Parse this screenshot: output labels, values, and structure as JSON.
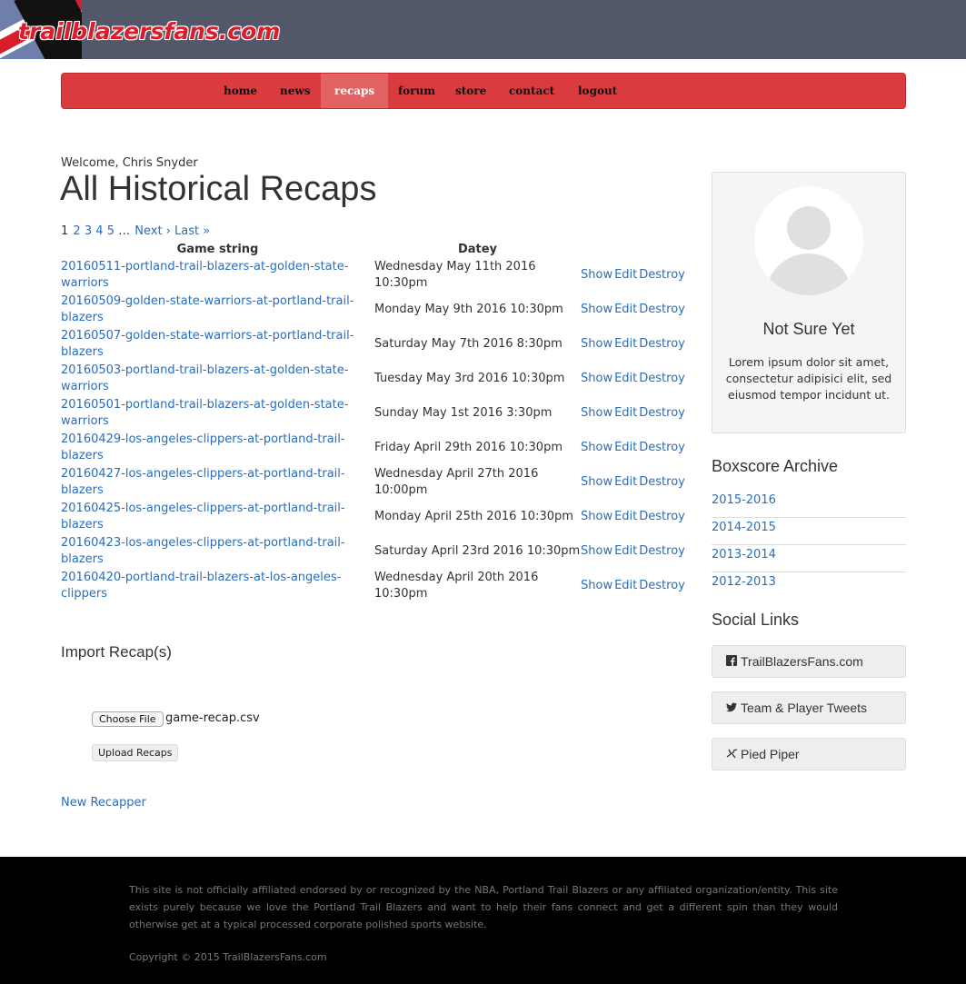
{
  "site": {
    "logo_text": "trailblazersfans.com"
  },
  "nav": {
    "items": [
      {
        "label": "home"
      },
      {
        "label": "news"
      },
      {
        "label": "recaps"
      },
      {
        "label": "forum"
      },
      {
        "label": "store"
      },
      {
        "label": "contact"
      },
      {
        "label": "logout"
      }
    ]
  },
  "welcome": "Welcome, Chris Snyder",
  "page_title": "All Historical Recaps",
  "pager": {
    "pages": [
      "1",
      "2",
      "3",
      "4",
      "5"
    ],
    "ellipsis": "…",
    "next": "Next ›",
    "last": "Last »"
  },
  "table": {
    "headers": {
      "game_string": "Game string",
      "date": "Datey"
    },
    "actions": {
      "show": "Show",
      "edit": "Edit",
      "destroy": "Destroy"
    },
    "rows": [
      {
        "game": "20160511-portland-trail-blazers-at-golden-state-warriors",
        "date": "Wednesday May 11th 2016 10:30pm"
      },
      {
        "game": "20160509-golden-state-warriors-at-portland-trail-blazers",
        "date": "Monday May 9th 2016 10:30pm"
      },
      {
        "game": "20160507-golden-state-warriors-at-portland-trail-blazers",
        "date": "Saturday May 7th 2016 8:30pm"
      },
      {
        "game": "20160503-portland-trail-blazers-at-golden-state-warriors",
        "date": "Tuesday May 3rd 2016 10:30pm"
      },
      {
        "game": "20160501-portland-trail-blazers-at-golden-state-warriors",
        "date": "Sunday May 1st 2016 3:30pm"
      },
      {
        "game": "20160429-los-angeles-clippers-at-portland-trail-blazers",
        "date": "Friday April 29th 2016 10:30pm"
      },
      {
        "game": "20160427-los-angeles-clippers-at-portland-trail-blazers",
        "date": "Wednesday April 27th 2016 10:00pm"
      },
      {
        "game": "20160425-los-angeles-clippers-at-portland-trail-blazers",
        "date": "Monday April 25th 2016 10:30pm"
      },
      {
        "game": "20160423-los-angeles-clippers-at-portland-trail-blazers",
        "date": "Saturday April 23rd 2016 10:30pm"
      },
      {
        "game": "20160420-portland-trail-blazers-at-los-angeles-clippers",
        "date": "Wednesday April 20th 2016 10:30pm"
      }
    ]
  },
  "import": {
    "title": "Import Recap(s)",
    "choose_label": "Choose File",
    "file_name": "game-recap.csv",
    "upload_label": "Upload Recaps"
  },
  "new_recapper": "New Recapper",
  "profile": {
    "name": "Not Sure Yet",
    "description": "Lorem ipsum dolor sit amet, consectetur adipisici elit, sed eiusmod tempor incidunt ut."
  },
  "archive": {
    "title": "Boxscore Archive",
    "items": [
      "2015-2016",
      "2014-2015",
      "2013-2014",
      "2012-2013"
    ]
  },
  "social": {
    "title": "Social Links",
    "items": [
      {
        "label": "TrailBlazersFans.com",
        "icon": "facebook-icon"
      },
      {
        "label": "Team & Player Tweets",
        "icon": "twitter-icon"
      },
      {
        "label": "Pied Piper",
        "icon": "pied-piper-icon"
      }
    ]
  },
  "footer": {
    "disclaimer": "This site is not officially affiliated endorsed by or recognized by the NBA, Portland Trail Blazers or any affiliated organization/entity. This site exists purely because we love the Portland Trail Blazers and want to help their fans connect and get a different spin than they would otherwise get at a typical processed corporate polished sports website.",
    "copyright": "Copyright © 2015 TrailBlazersFans.com"
  },
  "colors": {
    "nav": "#da3b3e",
    "header": "#525769",
    "link": "#2a6ebb"
  }
}
